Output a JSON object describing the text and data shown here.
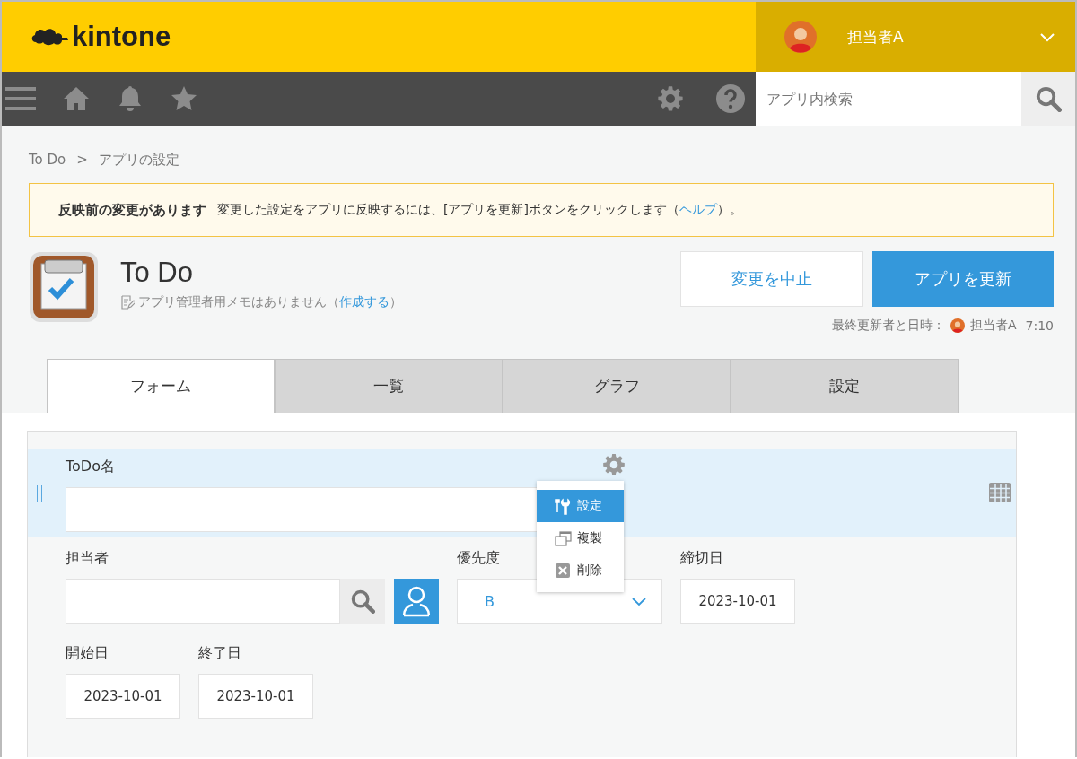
{
  "header": {
    "logo": "kintone",
    "user": {
      "name": "担当者A"
    }
  },
  "toolbar": {
    "search": {
      "placeholder": "アプリ内検索"
    }
  },
  "breadcrumb": [
    "To Do",
    ">",
    "アプリの設定"
  ],
  "notice": {
    "title": "反映前の変更があります",
    "text": "変更した設定をアプリに反映するには、[アプリを更新]ボタンをクリックします（",
    "link": "ヘルプ",
    "after": "）。"
  },
  "app": {
    "title": "To Do",
    "memo": "アプリ管理者用メモはありません（",
    "memo_link": "作成する",
    "memo_after": "）",
    "cancel_button": "変更を中止",
    "update_button": "アプリを更新",
    "updated_label": "最終更新者と日時：",
    "updated_user": "担当者A",
    "updated_time": "7:10"
  },
  "tabs": [
    {
      "label": "フォーム",
      "selected": true
    },
    {
      "label": "一覧",
      "selected": false
    },
    {
      "label": "グラフ",
      "selected": false
    },
    {
      "label": "設定",
      "selected": false
    }
  ],
  "form": {
    "rows": [
      {
        "selected": true,
        "fields": [
          {
            "kind": "text",
            "label": "ToDo名"
          }
        ]
      },
      {
        "selected": false,
        "fields": [
          {
            "kind": "user",
            "label": "担当者"
          },
          {
            "kind": "dropdown",
            "label": "優先度",
            "value": "B"
          },
          {
            "kind": "date",
            "label": "締切日",
            "value": "2023-10-01"
          }
        ]
      },
      {
        "selected": false,
        "fields": [
          {
            "kind": "date",
            "label": "開始日",
            "value": "2023-10-01"
          },
          {
            "kind": "date",
            "label": "終了日",
            "value": "2023-10-01"
          }
        ]
      }
    ],
    "menu": [
      {
        "kind": "settings",
        "label": "設定",
        "selected": true
      },
      {
        "kind": "copy",
        "label": "複製",
        "selected": false
      },
      {
        "kind": "delete",
        "label": "削除",
        "selected": false
      }
    ]
  }
}
